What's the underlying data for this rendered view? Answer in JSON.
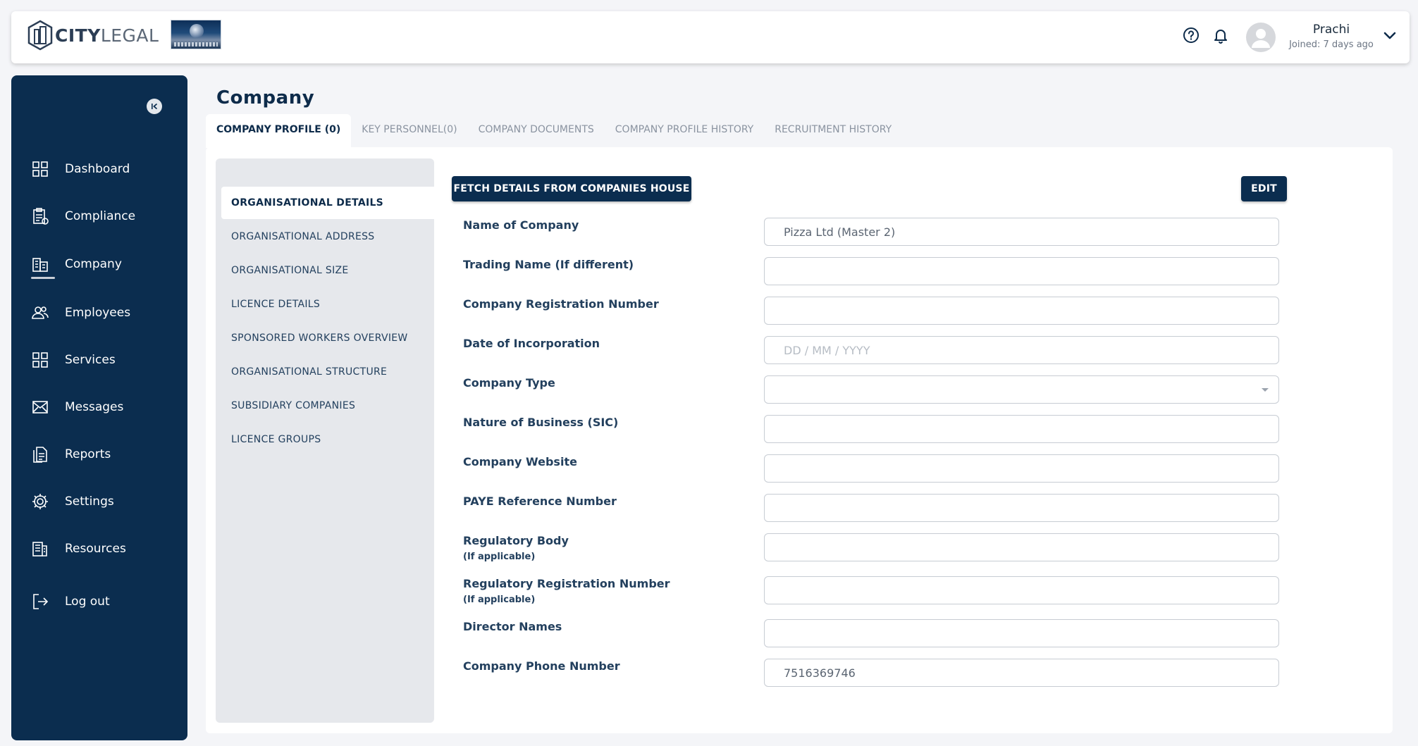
{
  "header": {
    "brand_bold": "CITY",
    "brand_light": "LEGAL",
    "user_name": "Prachi",
    "user_joined": "Joined: 7 days ago"
  },
  "sidebar": {
    "items": [
      {
        "label": "Dashboard",
        "icon": "grid-icon"
      },
      {
        "label": "Compliance",
        "icon": "clipboard-icon"
      },
      {
        "label": "Company",
        "icon": "building-icon"
      },
      {
        "label": "Employees",
        "icon": "users-icon"
      },
      {
        "label": "Services",
        "icon": "grid-icon"
      },
      {
        "label": "Messages",
        "icon": "envelope-icon"
      },
      {
        "label": "Reports",
        "icon": "document-icon"
      },
      {
        "label": "Settings",
        "icon": "gear-icon"
      },
      {
        "label": "Resources",
        "icon": "library-icon"
      },
      {
        "label": "Log out",
        "icon": "logout-icon"
      }
    ]
  },
  "page": {
    "title": "Company"
  },
  "tabs": [
    {
      "label": "COMPANY PROFILE (0)"
    },
    {
      "label": "KEY PERSONNEL(0)"
    },
    {
      "label": "COMPANY DOCUMENTS"
    },
    {
      "label": "COMPANY PROFILE HISTORY"
    },
    {
      "label": "RECRUITMENT HISTORY"
    }
  ],
  "subnav": [
    {
      "label": "ORGANISATIONAL DETAILS"
    },
    {
      "label": "ORGANISATIONAL ADDRESS"
    },
    {
      "label": "ORGANISATIONAL SIZE"
    },
    {
      "label": "LICENCE DETAILS"
    },
    {
      "label": "SPONSORED WORKERS OVERVIEW"
    },
    {
      "label": "ORGANISATIONAL STRUCTURE"
    },
    {
      "label": "SUBSIDIARY COMPANIES"
    },
    {
      "label": "LICENCE GROUPS"
    }
  ],
  "actions": {
    "fetch_label": "FETCH DETAILS FROM COMPANIES HOUSE",
    "edit_label": "EDIT"
  },
  "form": {
    "fields": [
      {
        "label": "Name of Company",
        "sub": "",
        "value": "Pizza Ltd (Master 2)",
        "placeholder": ""
      },
      {
        "label": "Trading Name (If different)",
        "sub": "",
        "value": "",
        "placeholder": ""
      },
      {
        "label": "Company Registration Number",
        "sub": "",
        "value": "",
        "placeholder": ""
      },
      {
        "label": "Date of Incorporation",
        "sub": "",
        "value": "",
        "placeholder": "DD / MM / YYYY"
      },
      {
        "label": "Company Type",
        "sub": "",
        "value": "",
        "placeholder": ""
      },
      {
        "label": "Nature of Business (SIC)",
        "sub": "",
        "value": "",
        "placeholder": ""
      },
      {
        "label": "Company Website",
        "sub": "",
        "value": "",
        "placeholder": ""
      },
      {
        "label": "PAYE Reference Number",
        "sub": "",
        "value": "",
        "placeholder": ""
      },
      {
        "label": "Regulatory Body",
        "sub": "(If applicable)",
        "value": "",
        "placeholder": ""
      },
      {
        "label": "Regulatory Registration Number",
        "sub": "(If applicable)",
        "value": "",
        "placeholder": ""
      },
      {
        "label": "Director Names",
        "sub": "",
        "value": "",
        "placeholder": ""
      },
      {
        "label": "Company Phone Number",
        "sub": "",
        "value": "7516369746",
        "placeholder": ""
      }
    ]
  },
  "colors": {
    "sidebar_bg": "#0b2d4f",
    "primary_button": "#0b2d4f",
    "subnav_bg": "#e6e8ec"
  }
}
